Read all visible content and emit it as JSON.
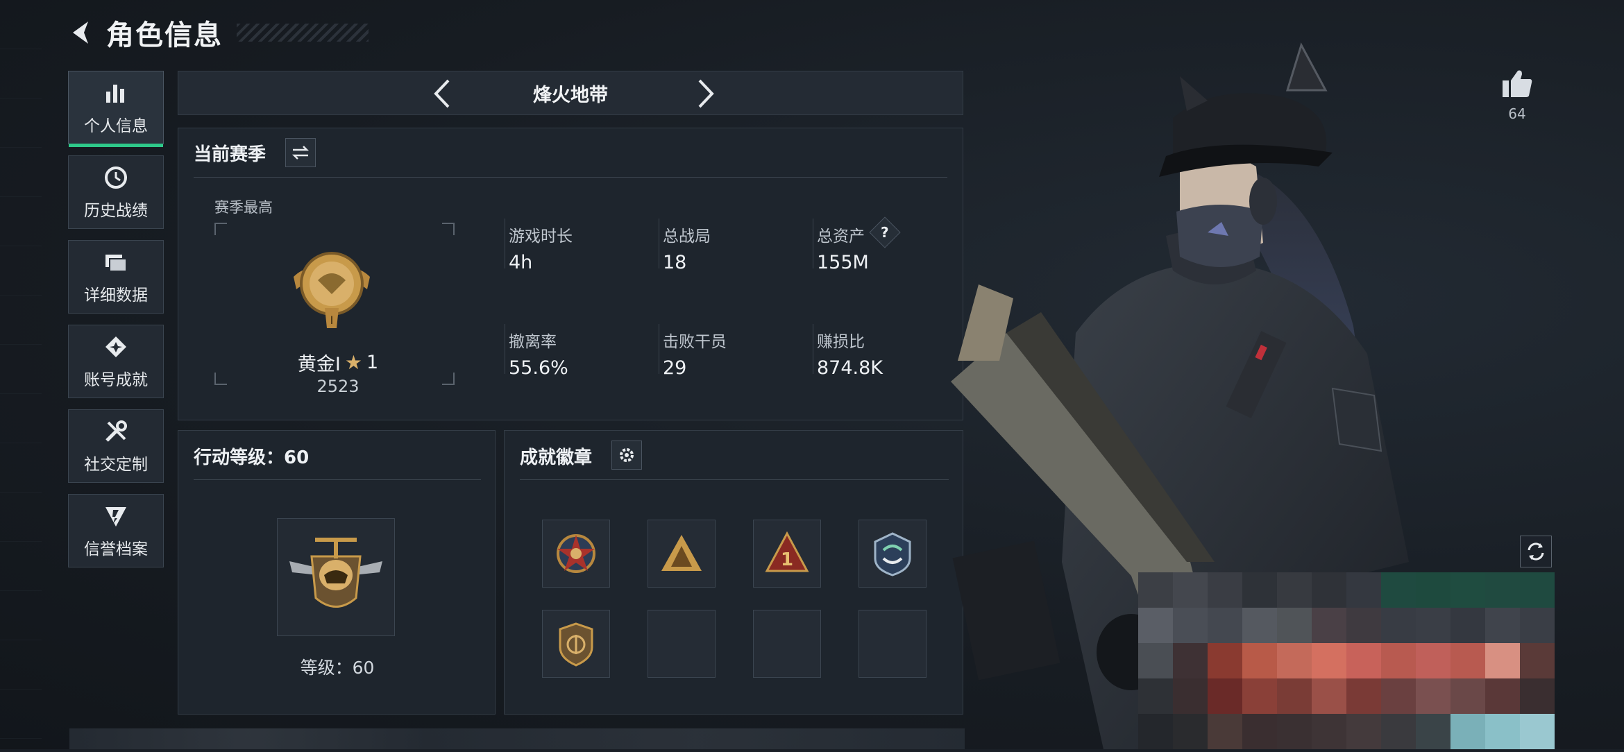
{
  "header": {
    "title": "角色信息"
  },
  "sidebar": {
    "items": [
      {
        "label": "个人信息",
        "icon": "bar-chart-icon",
        "active": true
      },
      {
        "label": "历史战绩",
        "icon": "history-icon"
      },
      {
        "label": "详细数据",
        "icon": "folder-icon"
      },
      {
        "label": "账号成就",
        "icon": "achievement-icon"
      },
      {
        "label": "社交定制",
        "icon": "tools-icon"
      },
      {
        "label": "信誉档案",
        "icon": "shield-icon"
      }
    ]
  },
  "mode": {
    "label": "烽火地带"
  },
  "season": {
    "title": "当前赛季",
    "best_label": "赛季最高",
    "rank_name": "黄金Ⅰ",
    "rank_stars": "1",
    "rank_score": "2523",
    "stats": [
      {
        "label": "游戏时长",
        "value": "4h"
      },
      {
        "label": "总战局",
        "value": "18"
      },
      {
        "label": "总资产",
        "value": "155M",
        "help": "?"
      },
      {
        "label": "撤离率",
        "value": "55.6%"
      },
      {
        "label": "击败干员",
        "value": "29"
      },
      {
        "label": "赚损比",
        "value": "874.8K"
      }
    ]
  },
  "action_level": {
    "title": "行动等级：60",
    "level_text": "等级：60"
  },
  "achievements": {
    "title": "成就徽章",
    "badges": [
      "star-emblem-icon",
      "triangle-squad-icon",
      "triangle-one-icon",
      "arrows-emblem-icon",
      "shield-crest-icon",
      "",
      "",
      ""
    ]
  },
  "likes": {
    "count": "64"
  },
  "colors": {
    "accent": "#2ec98a",
    "gold": "#c89a4a",
    "panel": "#1e252d"
  }
}
